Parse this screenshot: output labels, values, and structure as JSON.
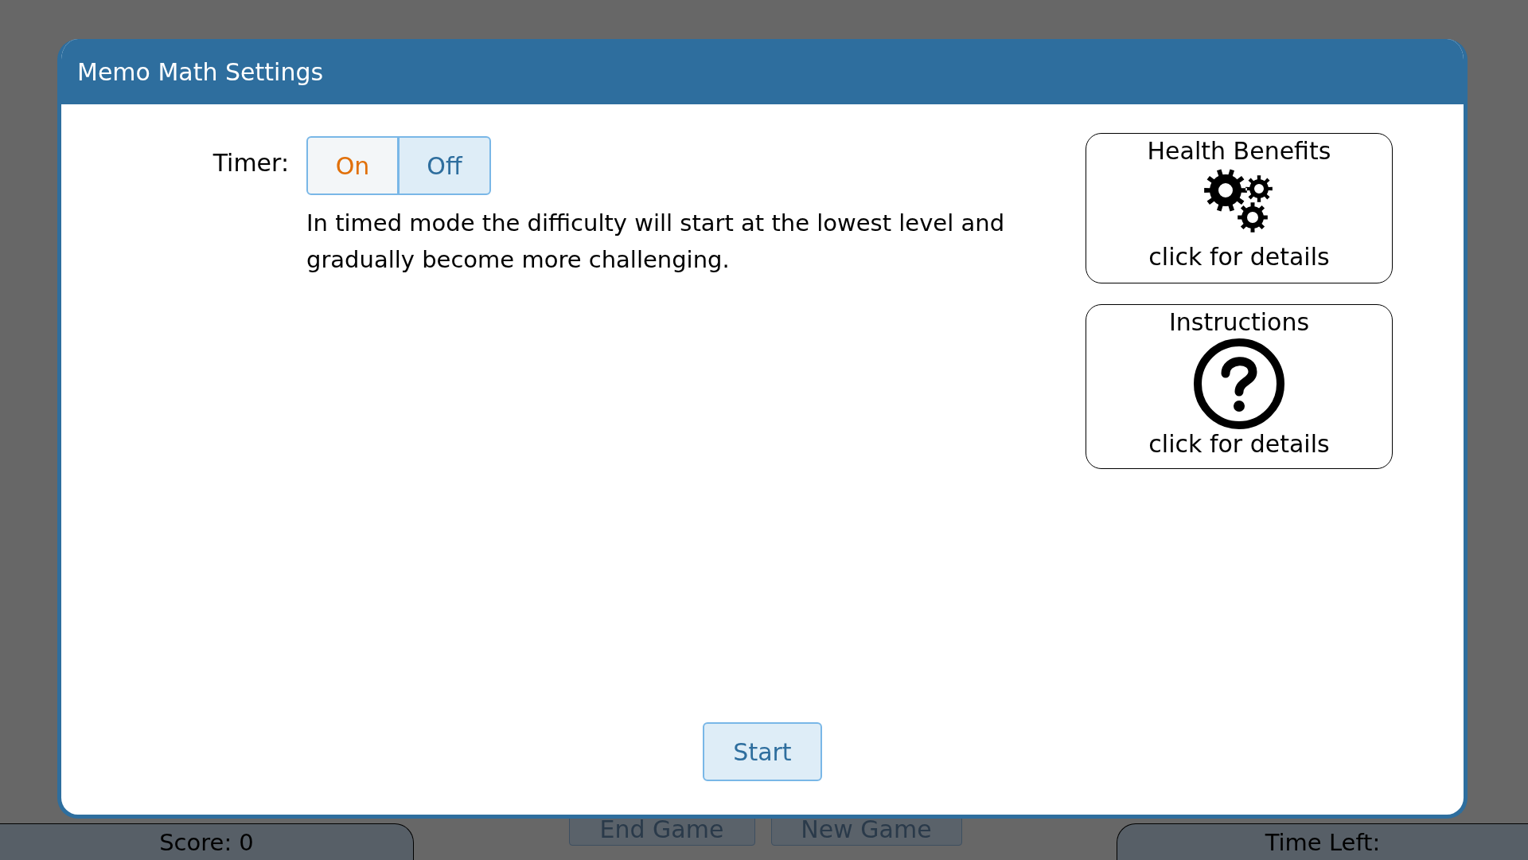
{
  "dialog": {
    "title": "Memo Math Settings",
    "timer": {
      "label": "Timer:",
      "options": [
        {
          "label": "On",
          "selected": true
        },
        {
          "label": "Off",
          "selected": false
        }
      ]
    },
    "description": "In timed mode the difficulty will start at the lowest level and gradually become more challenging.",
    "cards": [
      {
        "kind": "gears",
        "title": "Health Benefits",
        "caption": "click for details"
      },
      {
        "kind": "question",
        "title": "Instructions",
        "caption": "click for details"
      }
    ],
    "start_button": "Start"
  },
  "background": {
    "score": "Score: 0",
    "buttons": [
      "End Game",
      "New Game"
    ],
    "time_left": "Time Left:"
  }
}
